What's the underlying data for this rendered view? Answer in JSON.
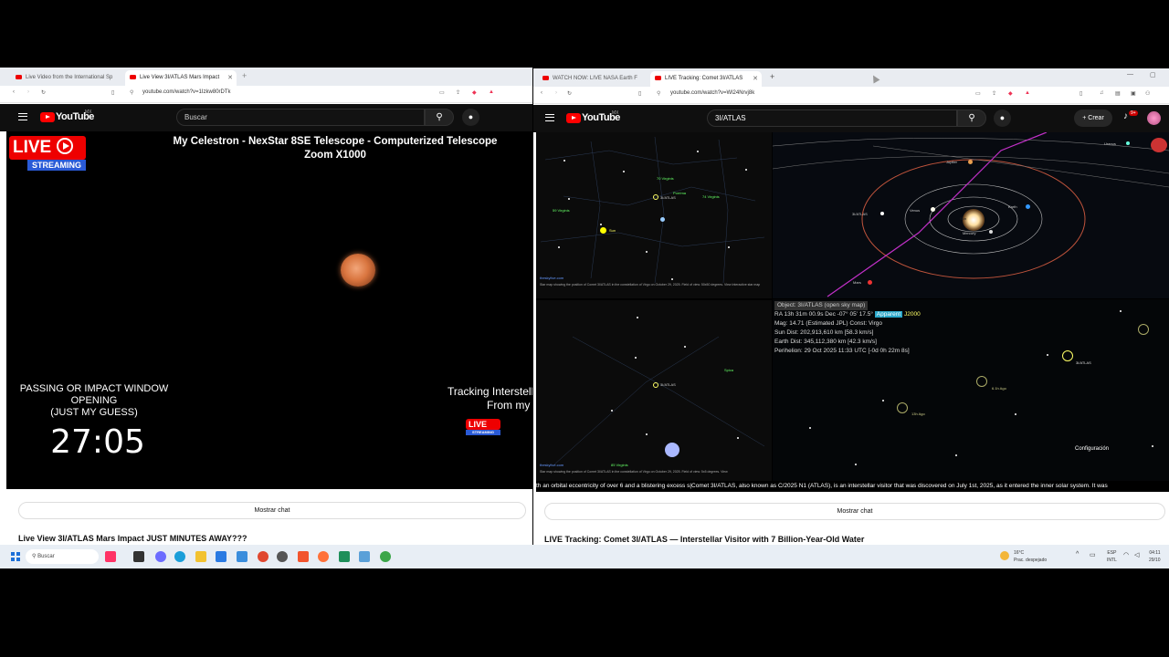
{
  "left_window": {
    "tabs": [
      {
        "label": "Live Video from the International Sp"
      },
      {
        "label": "Live View 3I/ATLAS Mars Impact"
      }
    ],
    "url": "youtube.com/watch?v=1Izkw80rDTk",
    "youtube": {
      "logo_text": "YouTube",
      "region": "MX",
      "search_placeholder": "Buscar"
    },
    "video": {
      "overlay_title_line1": "My Celestron - NexStar 8SE Telescope - Computerized Telescope",
      "overlay_title_line2": "Zoom X1000",
      "live_badge_top": "LIVE",
      "live_badge_bottom": "STREAMING",
      "window_text_line1": "PASSING OR IMPACT WINDOW",
      "window_text_line2": "OPENING",
      "window_text_line3": "(JUST MY GUESS)",
      "countdown": "27:05",
      "tracking_line1": "Tracking Interstell",
      "tracking_line2": "From my"
    },
    "chat_button": "Mostrar chat",
    "video_title": "Live View 3I/ATLAS Mars Impact JUST MINUTES AWAY???"
  },
  "right_window": {
    "tabs": [
      {
        "label": "WATCH NOW: LIVE NASA Earth F"
      },
      {
        "label": "LIVE Tracking: Comet 3I/ATLAS"
      }
    ],
    "url": "youtube.com/watch?v=Wl24Nrvj8k",
    "youtube": {
      "logo_text": "YouTube",
      "region": "MX",
      "search_value": "3I/ATLAS",
      "create_label": "Crear",
      "notif_count": "9+"
    },
    "skymap": {
      "site": "theskylive.com",
      "caption": "Star map showing the position of Comet 3I/ATLAS in the constellation of Virgo on October 29, 2025. Field of view: 50x50 degrees. View Interactive star map",
      "caption2": "Star map showing the position of Comet 3I/ATLAS in the constellation of Virgo on October 29, 2025. Field of view: 5x5 degrees. View",
      "comet_label": "3I/ATLAS",
      "sun_label": "Sun",
      "green_labels": [
        "59 Virginis",
        "70 Virginis",
        "Porrima",
        "74 Virginis",
        "Spica",
        "85 Virginis"
      ]
    },
    "orbit": {
      "planets": [
        "Jupiter",
        "Venus",
        "Earth",
        "Mercury",
        "Mars",
        "Uranus"
      ],
      "comet": "3I/ATLAS",
      "sun": "Sun"
    },
    "infobox": {
      "object": "Object: 3I/ATLAS  (open sky map)",
      "ra_line": "RA 13h 31m 00.9s Dec -07° 05' 17.5°",
      "epoch_badge": "Apparent",
      "epoch": "J2000",
      "mag_line": "Mag: 14.71 (Estimated JPL)  Const: Virgo",
      "sun_dist": "Sun Dist: 202,913,610 km [58.3 km/s]",
      "earth_dist": "Earth Dist: 345,112,380 km [42.3 km/s]",
      "perihelion": "Perihelion: 29 Oct 2025 11:33 UTC [-0d 0h 22m 8s]"
    },
    "deepsky": {
      "comet_label": "3I/ATLAS",
      "ago1": "6.1h Ago",
      "ago2": "13h Ago",
      "config": "Configuración"
    },
    "ticker": "th an orbital eccentricity of over 6 and a blistering excess s|Comet 3I/ATLAS, also known as C/2025 N1 (ATLAS), is an interstellar visitor that was discovered on July 1st, 2025, as it entered the inner solar system. It was",
    "chat_button": "Mostrar chat",
    "video_title": "LIVE Tracking: Comet 3I/ATLAS — Interstellar Visitor with 7 Billion-Year-Old Water"
  },
  "taskbar": {
    "search": "Buscar",
    "weather_temp": "16°C",
    "weather_desc": "Prac. despejado",
    "lang1": "ESP",
    "lang2": "INTL",
    "time": "04:11",
    "date": "29/10"
  }
}
